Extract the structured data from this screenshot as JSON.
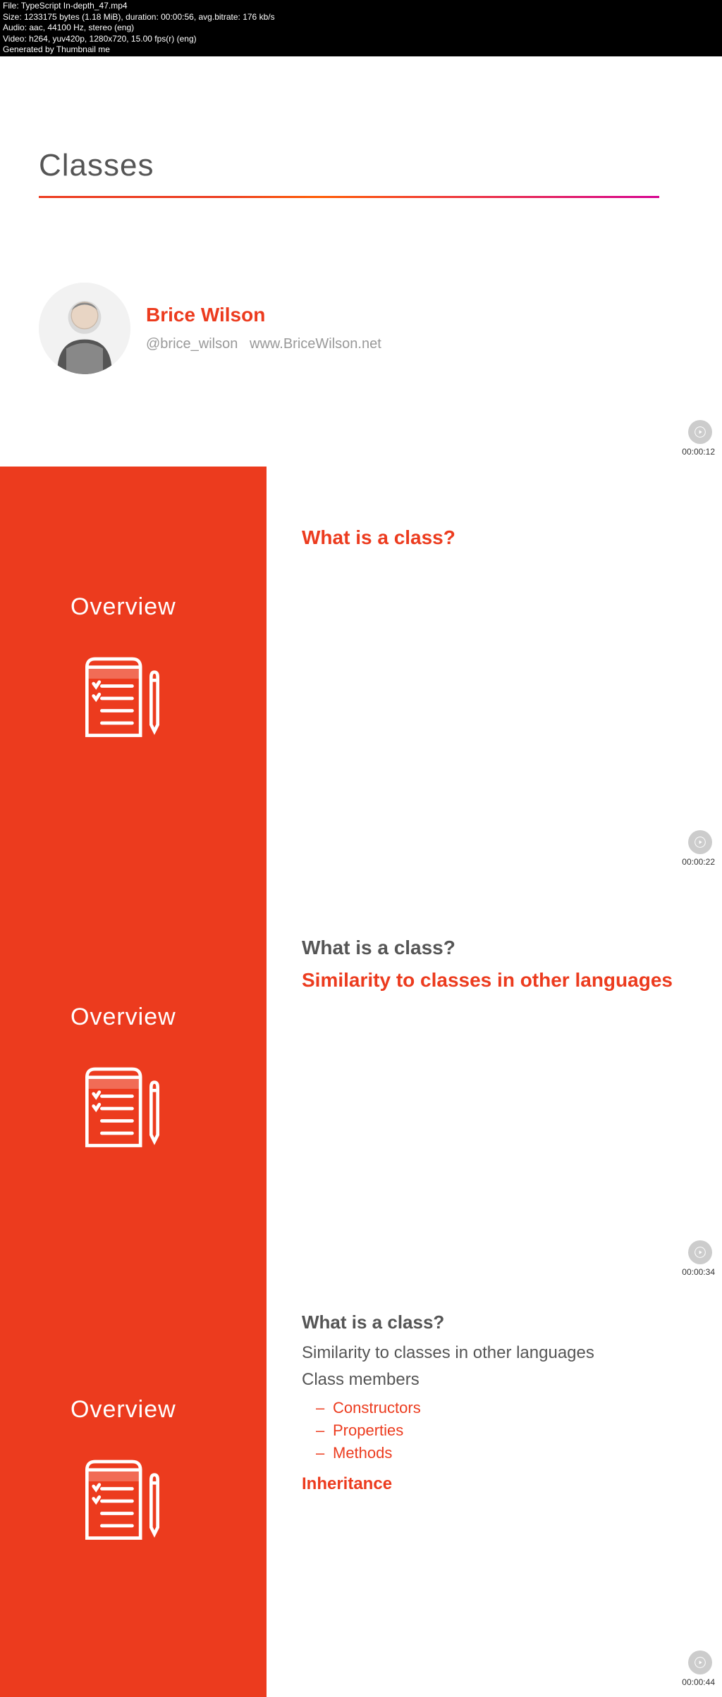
{
  "meta": {
    "file": "File: TypeScript In-depth_47.mp4",
    "size": "Size: 1233175 bytes (1.18 MiB), duration: 00:00:56, avg.bitrate: 176 kb/s",
    "audio": "Audio: aac, 44100 Hz, stereo (eng)",
    "video": "Video: h264, yuv420p, 1280x720, 15.00 fps(r) (eng)",
    "gen": "Generated by Thumbnail me"
  },
  "title": "Classes",
  "author": {
    "name": "Brice Wilson",
    "handle": "@brice_wilson",
    "site": "www.BriceWilson.net"
  },
  "sidebar_title": "Overview",
  "slides": [
    {
      "timestamp": "00:00:12"
    },
    {
      "timestamp": "00:00:22",
      "q": "What is a class?"
    },
    {
      "timestamp": "00:00:34",
      "q": "What is a class?",
      "line2": "Similarity to classes in other languages"
    },
    {
      "timestamp": "00:00:44",
      "q": "What is a class?",
      "line2": "Similarity to classes in other languages",
      "line3": "Class members",
      "items": [
        "Constructors",
        "Properties",
        "Methods"
      ],
      "line4": "Inheritance"
    }
  ]
}
